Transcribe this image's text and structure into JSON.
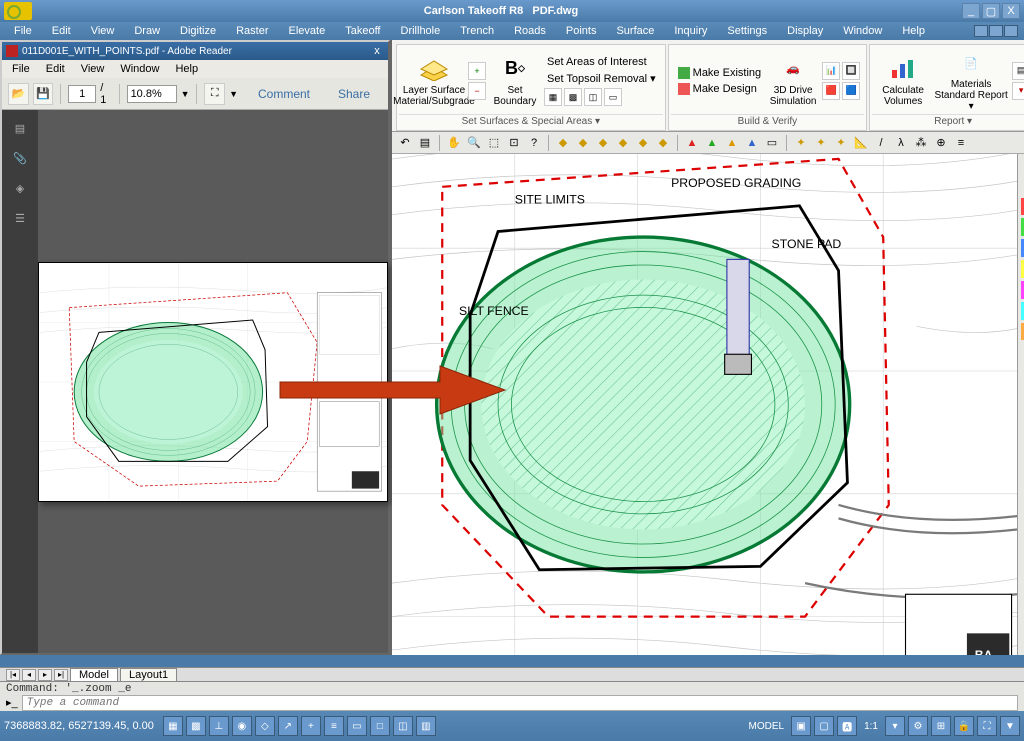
{
  "app": {
    "title_left": "Carlson Takeoff R8",
    "title_file": "PDF.dwg"
  },
  "menu": [
    "File",
    "Edit",
    "View",
    "Draw",
    "Digitize",
    "Raster",
    "Elevate",
    "Takeoff",
    "Drillhole",
    "Trench",
    "Roads",
    "Points",
    "Surface",
    "Inquiry",
    "Settings",
    "Display",
    "Window",
    "Help"
  ],
  "adobe": {
    "doc_title": "011D001E_WITH_POINTS.pdf - Adobe Reader",
    "menu": [
      "File",
      "Edit",
      "View",
      "Window",
      "Help"
    ],
    "page_current": "1",
    "page_total": "/ 1",
    "zoom": "10.8%",
    "comment_label": "Comment",
    "share_label": "Share"
  },
  "ribbon": {
    "group1_caption": "Set Surfaces & Special Areas ▾",
    "group2_caption": "Build & Verify",
    "group3_caption": "Report ▾",
    "btn_layer": "Layer Surface Material/Subgrade",
    "btn_boundary": "Set Boundary",
    "set_aoi": "Set Areas of Interest",
    "set_topsoil": "Set Topsoil Removal ▾",
    "make_existing": "Make Existing",
    "make_design": "Make Design",
    "btn_3d": "3D Drive Simulation",
    "btn_calc": "Calculate Volumes",
    "btn_report": "Materials Standard Report ▾"
  },
  "tabs": {
    "model": "Model",
    "layout1": "Layout1"
  },
  "cmd": {
    "out": "Command: '_.zoom _e",
    "placeholder": "Type a command"
  },
  "status": {
    "coords": "7368883.82, 6527139.45, 0.00",
    "model": "MODEL",
    "scale": "1:1"
  }
}
